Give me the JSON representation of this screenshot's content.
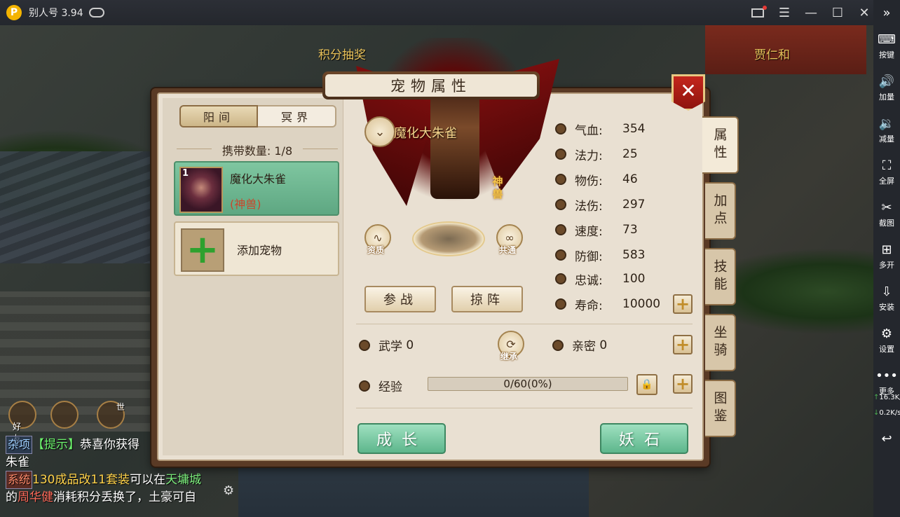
{
  "titlebar": {
    "app_title": "别人号 3.94",
    "logo_letter": "P",
    "buttons": [
      "mail-icon",
      "menu-icon",
      "minimize-icon",
      "maximize-icon",
      "close-icon",
      "collapse-icon"
    ]
  },
  "sidebar": {
    "items": [
      {
        "label": "按键",
        "icon": "keyboard-icon"
      },
      {
        "label": "加量",
        "icon": "volume-up-icon"
      },
      {
        "label": "减量",
        "icon": "volume-down-icon"
      },
      {
        "label": "全屏",
        "icon": "fullscreen-icon"
      },
      {
        "label": "截图",
        "icon": "scissors-icon"
      },
      {
        "label": "多开",
        "icon": "multi-instance-icon"
      },
      {
        "label": "安装",
        "icon": "apk-install-icon"
      },
      {
        "label": "设置",
        "icon": "gear-icon"
      },
      {
        "label": "更多",
        "icon": "more-icon"
      }
    ],
    "upload_speed": "16.3",
    "download_speed": "0.2",
    "speed_unit": "K/s"
  },
  "scene": {
    "npc_labels": [
      "积分抽奖",
      "贾仁和"
    ]
  },
  "panel": {
    "title": "宠物属性",
    "realm_tabs": [
      "阳间",
      "冥界"
    ],
    "carry_label": "携带数量:",
    "carry_value": "1/8",
    "pet": {
      "level": "1",
      "name": "魔化大朱雀",
      "type": "(神兽)"
    },
    "add_pet_label": "添加宠物",
    "model_name": "魔化大朱雀",
    "divine_badge": "神兽",
    "round_buttons": {
      "aptitude": "资质",
      "share": "共通",
      "inherit": "继承"
    },
    "action_buttons": {
      "battle": "参战",
      "formation": "掠阵"
    },
    "attributes": [
      {
        "name": "气血:",
        "value": "354",
        "icon": "heart-icon"
      },
      {
        "name": "法力:",
        "value": "25",
        "icon": "drop-icon"
      },
      {
        "name": "物伤:",
        "value": "46",
        "icon": "sword-icon"
      },
      {
        "name": "法伤:",
        "value": "297",
        "icon": "flame-icon"
      },
      {
        "name": "速度:",
        "value": "73",
        "icon": "bolt-icon"
      },
      {
        "name": "防御:",
        "value": "583",
        "icon": "shield-icon"
      },
      {
        "name": "忠诚:",
        "value": "100",
        "icon": "handshake-icon"
      },
      {
        "name": "寿命:",
        "value": "10000",
        "icon": "hourglass-icon"
      }
    ],
    "martial": {
      "label": "武学",
      "value": "0"
    },
    "intimacy": {
      "label": "亲密",
      "value": "0"
    },
    "exp": {
      "label": "经验",
      "text": "0/60(0%)",
      "progress": 0
    },
    "bottom_buttons": {
      "grow": "成长",
      "stone": "妖石"
    },
    "side_tabs": [
      "属性",
      "加点",
      "技能",
      "坐骑",
      "图鉴"
    ],
    "active_side_tab": "属性"
  },
  "chat": {
    "icons": {
      "friends": "好友",
      "world": "世"
    },
    "lines": {
      "misc_tag": "杂项",
      "hint_tag": "【提示】",
      "congrats": "恭喜你获得",
      "congrats_cont": "朱雀",
      "sys_tag": "系统",
      "item": "130成品改11套装",
      "can_at": "可以在",
      "place": "天墉城",
      "of": "的",
      "person": "周华健",
      "rest": "消耗积分丢换了，土豪可自"
    }
  }
}
